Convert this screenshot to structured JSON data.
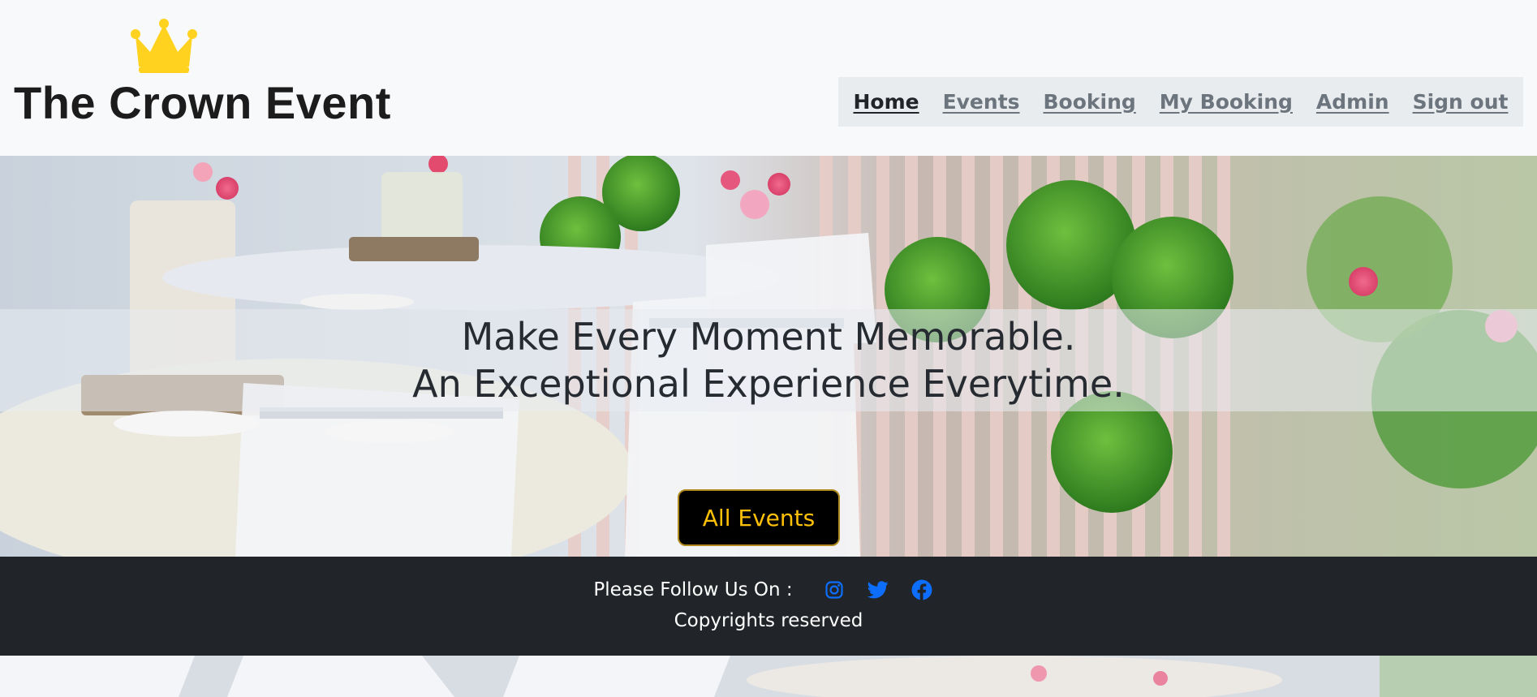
{
  "header": {
    "brand": "The Crown Event",
    "logo_icon": "crown-icon",
    "nav": [
      {
        "label": "Home",
        "active": true
      },
      {
        "label": "Events",
        "active": false
      },
      {
        "label": "Booking",
        "active": false
      },
      {
        "label": "My Booking",
        "active": false
      },
      {
        "label": "Admin",
        "active": false
      },
      {
        "label": "Sign out",
        "active": false
      }
    ]
  },
  "hero": {
    "tagline_line1": "Make Every Moment Memorable.",
    "tagline_line2": "An Exceptional Experience Everytime.",
    "cta_label": "All Events"
  },
  "footer": {
    "follow_text": "Please Follow Us On :",
    "social_icons": [
      "instagram-icon",
      "twitter-icon",
      "facebook-icon"
    ],
    "copyright": "Copyrights reserved"
  },
  "colors": {
    "crown": "#ffd21f",
    "cta_text": "#ffc107",
    "footer_bg": "#212529",
    "social_icon": "#0d6efd"
  }
}
